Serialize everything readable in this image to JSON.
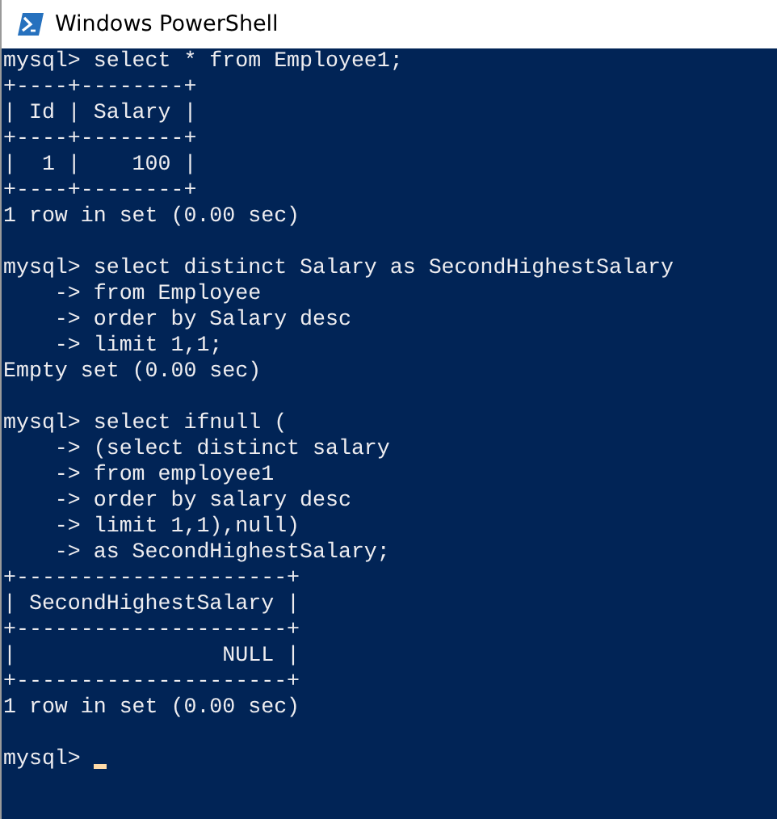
{
  "window": {
    "title": "Windows PowerShell"
  },
  "console": {
    "blocks": [
      {
        "lines": [
          "mysql> select * from Employee1;",
          "+----+--------+",
          "| Id | Salary |",
          "+----+--------+",
          "|  1 |    100 |",
          "+----+--------+",
          "1 row in set (0.00 sec)"
        ]
      },
      {
        "lines": [
          "mysql> select distinct Salary as SecondHighestSalary",
          "    -> from Employee",
          "    -> order by Salary desc",
          "    -> limit 1,1;",
          "Empty set (0.00 sec)"
        ]
      },
      {
        "lines": [
          "mysql> select ifnull (",
          "    -> (select distinct salary",
          "    -> from employee1",
          "    -> order by salary desc",
          "    -> limit 1,1),null)",
          "    -> as SecondHighestSalary;",
          "+---------------------+",
          "| SecondHighestSalary |",
          "+---------------------+",
          "|                NULL |",
          "+---------------------+",
          "1 row in set (0.00 sec)"
        ]
      },
      {
        "lines": [
          "mysql>"
        ]
      }
    ]
  }
}
